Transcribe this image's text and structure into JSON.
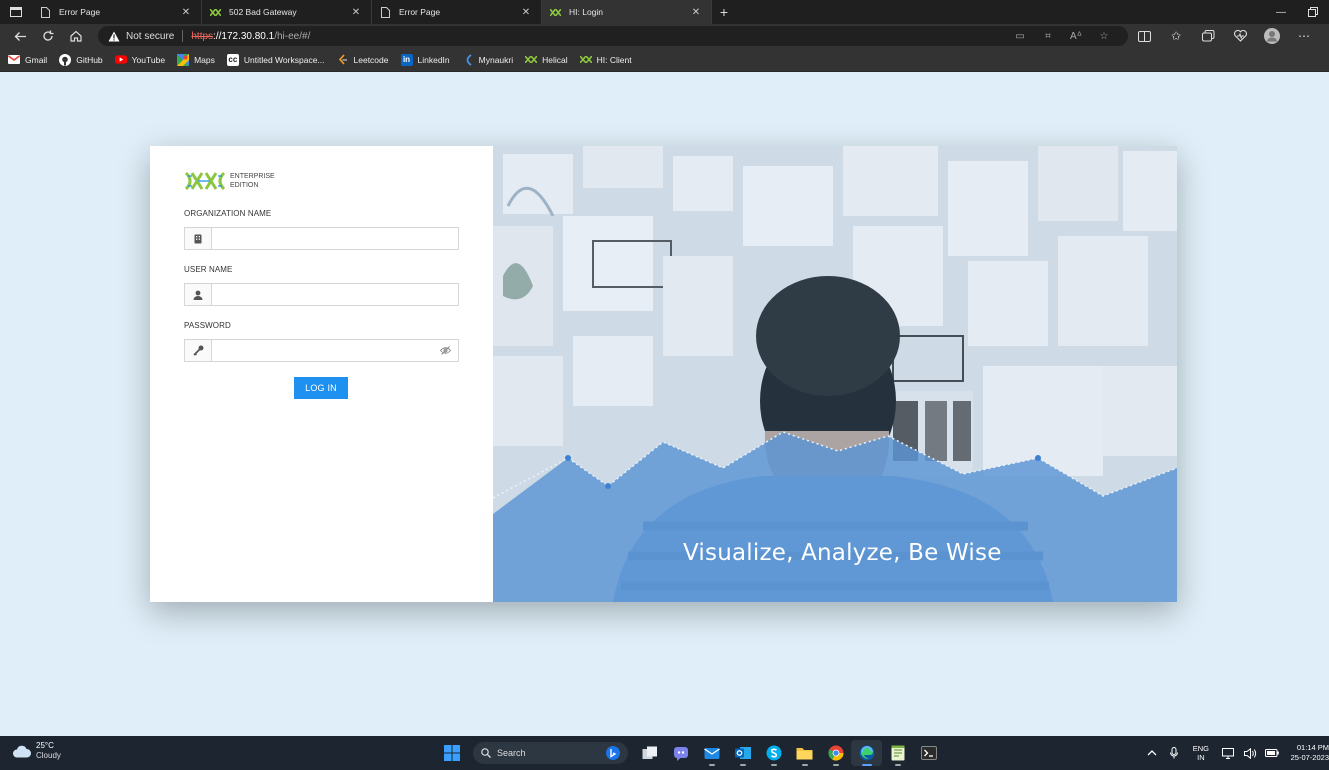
{
  "browser": {
    "tabs": [
      {
        "title": "Error Page",
        "icon": "page-icon",
        "active": false
      },
      {
        "title": "502 Bad Gateway",
        "icon": "helical-icon",
        "active": false
      },
      {
        "title": "Error Page",
        "icon": "page-icon",
        "active": false
      },
      {
        "title": "HI: Login",
        "icon": "helical-icon",
        "active": true
      }
    ],
    "address": {
      "security": "Not secure",
      "scheme": "https",
      "host": "://172.30.80.1",
      "path": "/hi-ee/#/"
    },
    "bookmarks": [
      {
        "label": "Gmail",
        "icon": "gmail-icon",
        "color": "#ea4335"
      },
      {
        "label": "GitHub",
        "icon": "github-icon",
        "color": "#ffffff"
      },
      {
        "label": "YouTube",
        "icon": "youtube-icon",
        "color": "#ff0000"
      },
      {
        "label": "Maps",
        "icon": "maps-icon",
        "color": "#34a853"
      },
      {
        "label": "Untitled Workspace...",
        "icon": "workspace-icon",
        "color": "#ffffff"
      },
      {
        "label": "Leetcode",
        "icon": "leetcode-icon",
        "color": "#f89f1b"
      },
      {
        "label": "LinkedIn",
        "icon": "linkedin-icon",
        "color": "#0a66c2"
      },
      {
        "label": "Mynaukri",
        "icon": "naukri-icon",
        "color": "#4a90e2"
      },
      {
        "label": "Helical",
        "icon": "helical-icon",
        "color": "#8dc63f"
      },
      {
        "label": "HI: Client",
        "icon": "helical-icon",
        "color": "#8dc63f"
      }
    ]
  },
  "login": {
    "logo_line1": "ENTERPRISE",
    "logo_line2": "EDITION",
    "org_label": "ORGANIZATION NAME",
    "org_value": "",
    "user_label": "USER NAME",
    "user_value": "",
    "password_label": "PASSWORD",
    "password_value": "",
    "login_button": "LOG IN",
    "tagline": "Visualize, Analyze, Be Wise"
  },
  "taskbar": {
    "weather_temp": "25°C",
    "weather_desc": "Cloudy",
    "search_label": "Search",
    "lang_top": "ENG",
    "lang_bottom": "IN",
    "time": "01:14 PM",
    "date": "25-07-2023"
  },
  "colors": {
    "accent": "#1e90f0",
    "logo_green": "#8dc63f",
    "page_bg": "#dfeef8",
    "hero_overlay": "#5b95d4"
  }
}
